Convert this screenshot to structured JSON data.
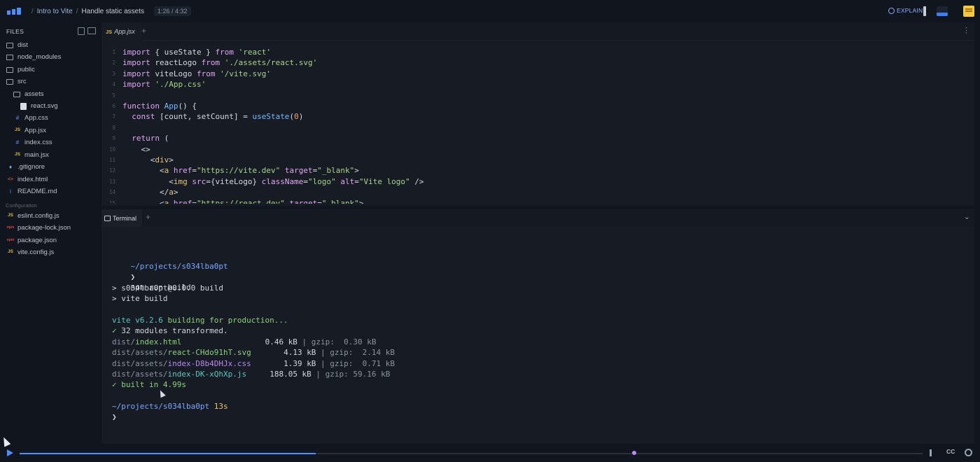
{
  "topbar": {
    "breadcrumb_course": "Intro to Vite",
    "breadcrumb_lesson": "Handle static assets",
    "separator": "/",
    "time": "1:26 / 4:32",
    "explain_label": "EXPLAIN"
  },
  "sidebar": {
    "files_label": "FILES",
    "config_label": "Configuration",
    "items": [
      {
        "label": "dist",
        "icon": "folder-icon"
      },
      {
        "label": "node_modules",
        "icon": "folder-icon"
      },
      {
        "label": "public",
        "icon": "folder-icon"
      },
      {
        "label": "src",
        "icon": "folder-open-icon"
      },
      {
        "label": "assets",
        "icon": "folder-open-icon"
      },
      {
        "label": "react.svg",
        "icon": "svg-file-icon"
      },
      {
        "label": "App.css",
        "icon": "css-file-icon",
        "glyph": "#"
      },
      {
        "label": "App.jsx",
        "icon": "js-file-icon",
        "glyph": "JS"
      },
      {
        "label": "index.css",
        "icon": "css-file-icon",
        "glyph": "#"
      },
      {
        "label": "main.jsx",
        "icon": "js-file-icon",
        "glyph": "JS"
      },
      {
        "label": ".gitignore",
        "icon": "git-file-icon",
        "glyph": "♦"
      },
      {
        "label": "index.html",
        "icon": "html-file-icon",
        "glyph": "<>"
      },
      {
        "label": "README.md",
        "icon": "info-file-icon",
        "glyph": "i"
      }
    ],
    "config_items": [
      {
        "label": "eslint.config.js",
        "icon": "js-file-icon",
        "glyph": "JS"
      },
      {
        "label": "package-lock.json",
        "icon": "npm-file-icon",
        "glyph": "npm"
      },
      {
        "label": "package.json",
        "icon": "npm-file-icon",
        "glyph": "npm"
      },
      {
        "label": "vite.config.js",
        "icon": "js-file-icon",
        "glyph": "JS"
      }
    ]
  },
  "editor": {
    "tab_label": "App.jsx",
    "tab_badge": "JS",
    "lines": [
      {
        "n": "1",
        "text": "import { useState } from 'react'"
      },
      {
        "n": "2",
        "text": "import reactLogo from './assets/react.svg'"
      },
      {
        "n": "3",
        "text": "import viteLogo from '/vite.svg'"
      },
      {
        "n": "4",
        "text": "import './App.css'"
      },
      {
        "n": "5",
        "text": ""
      },
      {
        "n": "6",
        "text": "function App() {"
      },
      {
        "n": "7",
        "text": "  const [count, setCount] = useState(0)"
      },
      {
        "n": "8",
        "text": ""
      },
      {
        "n": "9",
        "text": "  return ("
      },
      {
        "n": "10",
        "text": "    <>"
      },
      {
        "n": "11",
        "text": "      <div>"
      },
      {
        "n": "12",
        "text": "        <a href=\"https://vite.dev\" target=\"_blank\">"
      },
      {
        "n": "13",
        "text": "          <img src={viteLogo} className=\"logo\" alt=\"Vite logo\" />"
      },
      {
        "n": "14",
        "text": "        </a>"
      },
      {
        "n": "15",
        "text": "        <a href=\"https://react.dev\" target=\"_blank\">"
      }
    ]
  },
  "terminal": {
    "tab_label": "Terminal",
    "path1": "~/projects/s034lba0pt",
    "prompt_symbol": "❯",
    "cmd": "npm run build",
    "out1": "> s034lba0pt@0.0.0 build",
    "out2": "> vite build",
    "vite_version": "vite v6.2.6",
    "building": " building for production...",
    "check": "✓",
    "modules": " 32 modules transformed.",
    "files": [
      {
        "dir": "dist/",
        "name": "index.html",
        "pad": "               ",
        "size": " 0.46 kB",
        "gzip": " 0.30 kB",
        "color": "t-green"
      },
      {
        "dir": "dist/assets/",
        "name": "react-CHdo91hT.svg",
        "pad": "    ",
        "size": " 4.13 kB",
        "gzip": " 2.14 kB",
        "color": "t-green"
      },
      {
        "dir": "dist/assets/",
        "name": "index-D8b4DHJx.css",
        "pad": "    ",
        "size": " 1.39 kB",
        "gzip": " 0.71 kB",
        "color": "t-purple"
      },
      {
        "dir": "dist/assets/",
        "name": "index-DK-xQhXp.js",
        "pad": "   ",
        "size": "188.05 kB",
        "gzip": "59.16 kB",
        "color": "t-cyan"
      }
    ],
    "gzip_label": "gzip:",
    "pipe": "|",
    "built": " built in 4.99s",
    "path2": "~/projects/s034lba0pt",
    "duration": "13s",
    "prompt2": "❯"
  },
  "player": {
    "progress_fraction": 0.328,
    "cc_label": "CC"
  },
  "colors": {
    "accent": "#4e8cff",
    "notes": "#f5c842",
    "marker": "#b58cf2"
  }
}
